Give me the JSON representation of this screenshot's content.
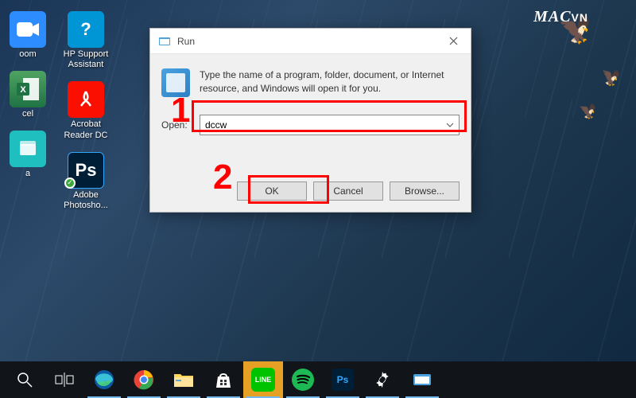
{
  "watermark": {
    "mac": "MAC",
    "vn": "VN"
  },
  "desktop_icons": {
    "zoom_label": "oom",
    "msinfo_label": "cel",
    "aqua_label": "a",
    "hp_label": "HP Support Assistant",
    "acrobat_label": "Acrobat Reader DC",
    "photoshop_label": "Adobe Photosho...",
    "hp_glyph": "?",
    "ps_glyph": "Ps",
    "check_glyph": "✓"
  },
  "run_dialog": {
    "title": "Run",
    "description": "Type the name of a program, folder, document, or Internet resource, and Windows will open it for you.",
    "open_label": "Open:",
    "open_value": "dccw",
    "ok_label": "OK",
    "cancel_label": "Cancel",
    "browse_label": "Browse..."
  },
  "annotations": {
    "num1": "1",
    "num2": "2"
  },
  "taskbar": {
    "line_text": "LINE",
    "ps_text": "Ps"
  }
}
